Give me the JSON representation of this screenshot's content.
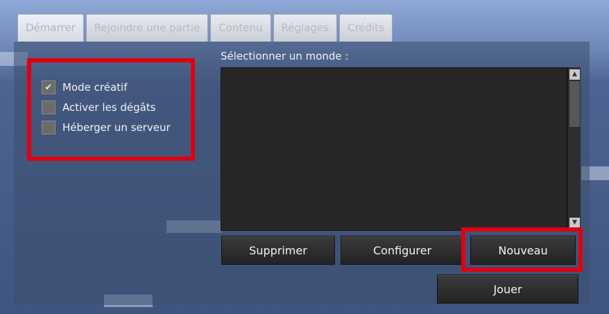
{
  "tabs": [
    {
      "label": "Démarrer",
      "active": true
    },
    {
      "label": "Rejoindre une partie",
      "active": false
    },
    {
      "label": "Contenu",
      "active": false
    },
    {
      "label": "Réglages",
      "active": false
    },
    {
      "label": "Crédits",
      "active": false
    }
  ],
  "options": {
    "creative_mode": {
      "label": "Mode créatif",
      "checked": true
    },
    "enable_damage": {
      "label": "Activer les dégâts",
      "checked": false
    },
    "host_server": {
      "label": "Héberger un serveur",
      "checked": false
    }
  },
  "world_select": {
    "label": "Sélectionner un monde :",
    "worlds": []
  },
  "buttons": {
    "delete": "Supprimer",
    "configure": "Configurer",
    "new": "Nouveau",
    "play": "Jouer"
  },
  "glyphs": {
    "check": "✔",
    "up": "▲",
    "down": "▼"
  },
  "colors": {
    "highlight": "#e0000f",
    "panel_dark": "#272727"
  }
}
